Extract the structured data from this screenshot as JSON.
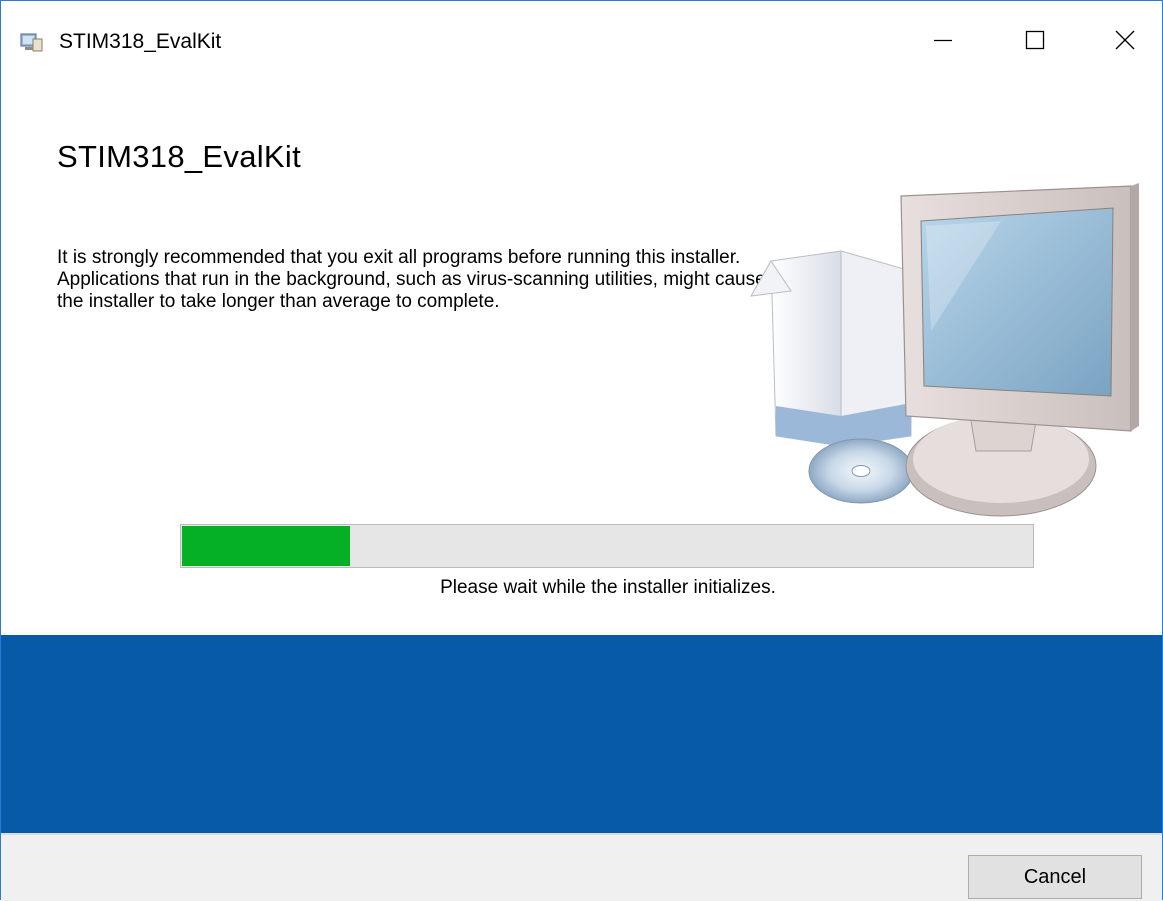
{
  "window": {
    "title": "STIM318_EvalKit",
    "controls": {
      "minimize": "minimize-icon",
      "maximize": "maximize-icon",
      "close": "close-icon"
    }
  },
  "main": {
    "heading": "STIM318_EvalKit",
    "description": "It is strongly recommended that you exit all programs before running this installer. Applications that run in the background, such as virus-scanning utilities, might cause the installer to take longer than average to complete.",
    "illustration": "computer-installer-icon"
  },
  "progress": {
    "status": "Please wait while the installer initializes.",
    "fraction": 0.2,
    "color": "#06b025"
  },
  "footer": {
    "cancel_label": "Cancel"
  },
  "colors": {
    "banner": "#065aa7",
    "window_border": "#2b7bd6",
    "footer": "#f0f0f0"
  }
}
